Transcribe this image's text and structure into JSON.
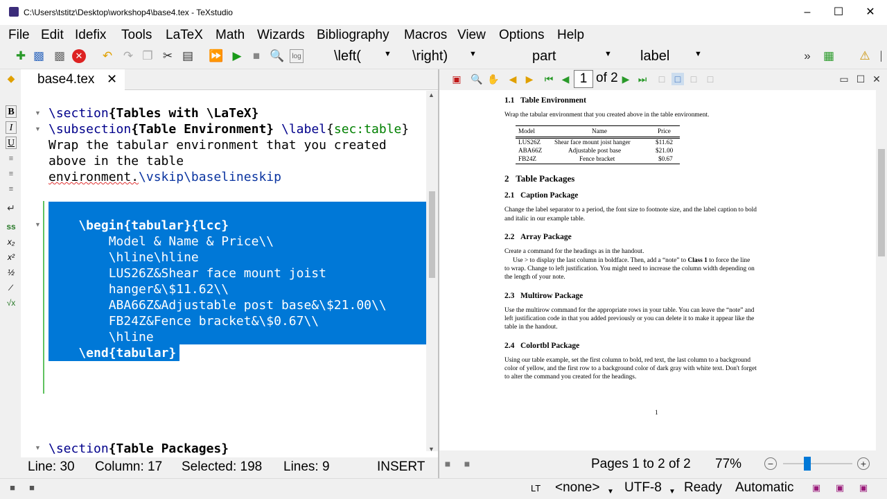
{
  "window": {
    "title": "C:\\Users\\tstitz\\Desktop\\workshop4\\base4.tex - TeXstudio"
  },
  "menu": [
    "File",
    "Edit",
    "Idefix",
    "Tools",
    "LaTeX",
    "Math",
    "Wizards",
    "Bibliography",
    "Macros",
    "View",
    "Options",
    "Help"
  ],
  "toolbar": {
    "left_combo": "\\left(",
    "right_combo": "\\right)",
    "part_combo": "part",
    "label_combo": "label"
  },
  "tab": {
    "name": "base4.tex"
  },
  "code": {
    "l1_cmd": "\\section",
    "l1_arg": "Tables with \\LaTeX",
    "l2_cmd": "\\subsection",
    "l2_arg": "Table Environment",
    "l2_label_cmd": "\\label",
    "l2_label_arg": "sec:table",
    "l3": "Wrap the tabular environment that you created",
    "l4": "above in the table",
    "l5_a": "environment.",
    "l5_b": "\\vskip\\baselineskip",
    "s1": "    \\begin{tabular}{lcc}",
    "s2": "        Model & Name & Price\\\\",
    "s3": "        \\hline\\hline",
    "s4": "        LUS26Z&Shear face mount joist",
    "s5": "        hanger&\\$11.62\\\\",
    "s6": "        ABA66Z&Adjustable post base&\\$21.00\\\\",
    "s7": "        FB24Z&Fence bracket&\\$0.67\\\\",
    "s8": "        \\hline",
    "s9": "    \\end{tabular}",
    "l_last_cmd": "\\section",
    "l_last_arg": "Table Packages"
  },
  "status": {
    "line": "Line: 30",
    "column": "Column: 17",
    "selected": "Selected: 198",
    "lines": "Lines: 9",
    "mode": "INSERT"
  },
  "pdf": {
    "page_current": "1",
    "page_of": "of 2",
    "s11_num": "1.1",
    "s11_title": "Table Environment",
    "s11_text": "Wrap the tabular environment that you created above in the table environment.",
    "table": {
      "headers": [
        "Model",
        "Name",
        "Price"
      ],
      "rows": [
        [
          "LUS26Z",
          "Shear face mount joist hanger",
          "$11.62"
        ],
        [
          "ABA66Z",
          "Adjustable post base",
          "$21.00"
        ],
        [
          "FB24Z",
          "Fence bracket",
          "$0.67"
        ]
      ]
    },
    "s2_num": "2",
    "s2_title": "Table Packages",
    "s21_num": "2.1",
    "s21_title": "Caption Package",
    "s21_p1": "Change the label separator to a period, the font size to footnote size, and the label caption to bold",
    "s21_p2": "and italic in our example table.",
    "s22_num": "2.2",
    "s22_title": "Array Package",
    "s22_p1": "Create a command for the headings as in the handout.",
    "s22_p2a": "Use > to display the last column in boldface.  Then, add a “note” to",
    "s22_p2b": "Class 1",
    "s22_p2c": "to force the line",
    "s22_p3": "to wrap.  Change to left justification.  You might need to increase the column width depending on",
    "s22_p4": "the length of your note.",
    "s23_num": "2.3",
    "s23_title": "Multirow Package",
    "s23_p1": "Use the multirow command for the appropriate rows in your table.  You can leave the “note” and",
    "s23_p2": "left justification code in that you added previously or you can delete it to make it appear like the",
    "s23_p3": "table in the handout.",
    "s24_num": "2.4",
    "s24_title": "Colortbl Package",
    "s24_p1": "Using our table example, set the first column to bold, red text, the last column to a background",
    "s24_p2": "color of yellow, and the first row to a background color of dark gray with white text.  Don't forget",
    "s24_p3": "to alter the command you created for the headings.",
    "page_number": "1"
  },
  "pdf_status": {
    "pages": "Pages 1 to 2 of 2",
    "zoom": "77%"
  },
  "bottom": {
    "lt": "LT",
    "none": "<none>",
    "encoding": "UTF-8",
    "ready": "Ready",
    "automatic": "Automatic"
  },
  "colors": {
    "selection": "#0078d7",
    "command": "#00008b",
    "argument": "#008000",
    "gutter": "#5fc25f"
  }
}
